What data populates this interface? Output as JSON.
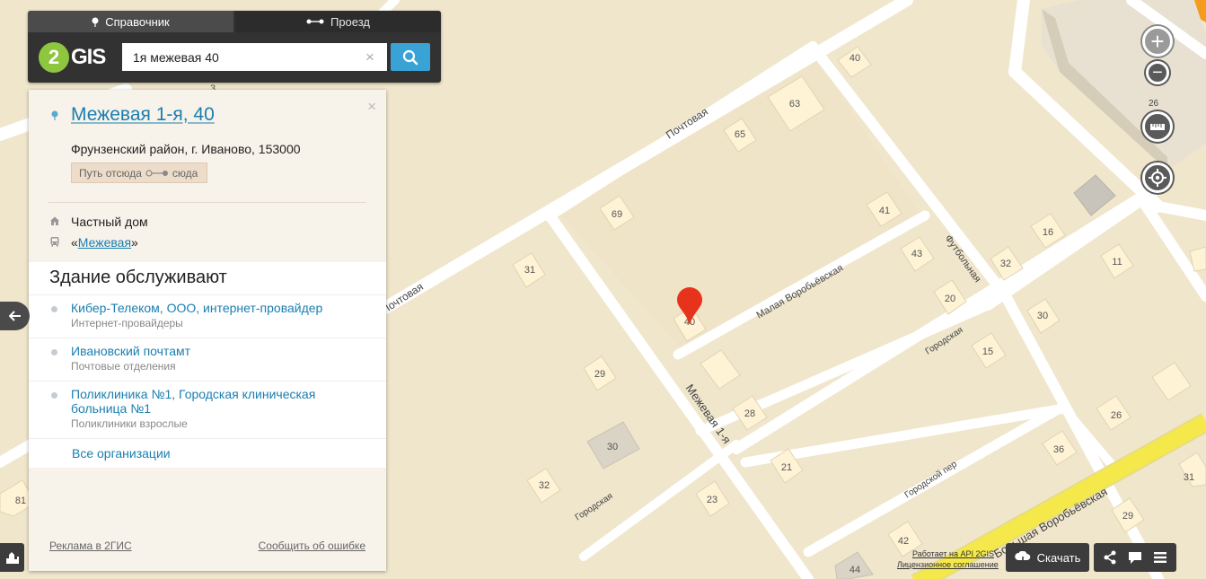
{
  "tabs": {
    "directory": "Справочник",
    "route": "Проезд"
  },
  "logo": {
    "digit": "2",
    "text": "GIS"
  },
  "search": {
    "value": "1я межевая 40",
    "clear": "×"
  },
  "card": {
    "title": "Межевая 1-я, 40",
    "address": "Фрунзенский район, г. Иваново, 153000",
    "route_from": "Путь отсюда",
    "route_to": "сюда",
    "building_type": "Частный дом",
    "stop_prefix": "«",
    "stop_name": "Межевая",
    "stop_suffix": "»",
    "close": "×",
    "orgs_title": "Здание обслуживают",
    "orgs": [
      {
        "name": "Кибер-Телеком, ООО, интернет-провайдер",
        "category": "Интернет-провайдеры"
      },
      {
        "name": "Ивановский почтамт",
        "category": "Почтовые отделения"
      },
      {
        "name": "Поликлиника №1, Городская клиническая больница №1",
        "category": "Поликлиники взрослые"
      }
    ],
    "all_orgs": "Все организации",
    "ads": "Реклама в 2ГИС",
    "report": "Сообщить об ошибке"
  },
  "map": {
    "zoom_level": "26",
    "zoom_in": "+",
    "zoom_out": "−",
    "api_text": "Работает на API 2GIS",
    "license": "Лицензионное соглашение",
    "download": "Скачать",
    "streets": [
      "Почтовая",
      "Почтовая",
      "Малая Воробьёвская",
      "Межевая 1-я",
      "Городская",
      "Городская",
      "Футбольная",
      "Городской пер",
      "Большая Воробьёвская"
    ],
    "houses": [
      "40",
      "63",
      "65",
      "69",
      "41",
      "31",
      "40",
      "43",
      "32",
      "16",
      "11",
      "20",
      "30",
      "29",
      "15",
      "28",
      "26",
      "30",
      "21",
      "36",
      "32",
      "23",
      "29",
      "42",
      "44",
      "81",
      "31",
      "3"
    ]
  },
  "colors": {
    "map_bg": "#f0e6cc",
    "road": "#ffffff",
    "highway": "#f4e84a",
    "marker": "#e8331c",
    "link": "#1a7fb0",
    "panel": "#323232"
  }
}
